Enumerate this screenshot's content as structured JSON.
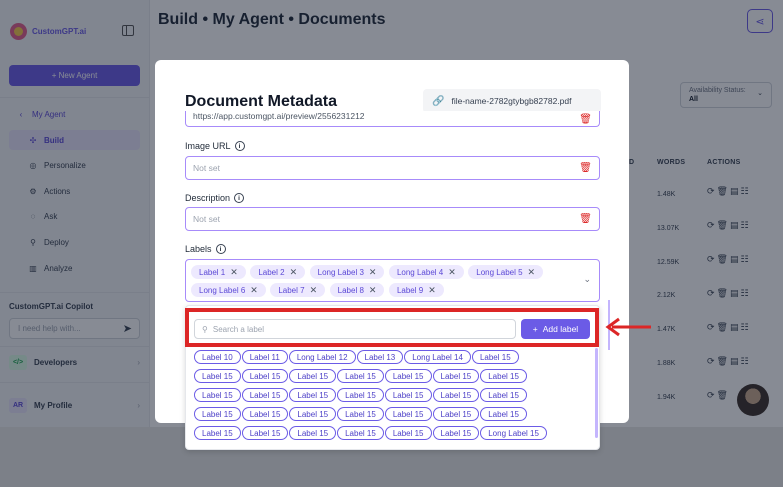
{
  "app": {
    "brand": "CustomGPT.ai",
    "new_agent": "+ New Agent",
    "nav_head": "My Agent",
    "nav": [
      {
        "label": "Build",
        "icon": "puzzle-icon"
      },
      {
        "label": "Personalize",
        "icon": "palette-icon"
      },
      {
        "label": "Actions",
        "icon": "bolt-icon"
      },
      {
        "label": "Ask",
        "icon": "chat-icon"
      },
      {
        "label": "Deploy",
        "icon": "rocket-icon"
      },
      {
        "label": "Analyze",
        "icon": "chart-icon"
      }
    ],
    "copilot_title": "CustomGPT.ai Copilot",
    "copilot_placeholder": "I need help with...",
    "developers": "Developers",
    "developers_badge": "</>",
    "profile": "My Profile",
    "profile_badge": "AR",
    "page_title": "Build • My Agent • Documents",
    "availability_label": "Availability Status:",
    "availability_value": "All",
    "col_d": "D",
    "col_words": "WORDS",
    "col_actions": "ACTIONS",
    "words": [
      "1.48K",
      "13.07K",
      "12.59K",
      "2.12K",
      "1.47K",
      "1.88K",
      "1.94K"
    ]
  },
  "modal": {
    "title": "Document Metadata",
    "file_name": "file-name-2782gtybgb82782.pdf",
    "url_value": "https://app.customgpt.ai/preview/2556231212",
    "image_url_label": "Image URL",
    "image_url_placeholder": "Not set",
    "description_label": "Description",
    "description_placeholder": "Not set",
    "labels_label": "Labels",
    "selected_labels": [
      "Label 1",
      "Label 2",
      "Long Label 3",
      "Long Label 4",
      "Long Label 5",
      "Long Label 6",
      "Label 7",
      "Label 8",
      "Label 9"
    ],
    "search_placeholder": "Search a label",
    "add_label": "Add label",
    "options": [
      "Label 10",
      "Label 11",
      "Long Label 12",
      "Label 13",
      "Long Label 14",
      "Label 15",
      "Label 15",
      "Label 15",
      "Label 15",
      "Label 15",
      "Label 15",
      "Label 15",
      "Label 15",
      "Label 15",
      "Label 15",
      "Label 15",
      "Label 15",
      "Label 15",
      "Label 15",
      "Label 15",
      "Label 15",
      "Label 15",
      "Label 15",
      "Label 15",
      "Label 15",
      "Label 15",
      "Label 15",
      "Label 15",
      "Label 15",
      "Label 15",
      "Label 15",
      "Label 15",
      "Label 15",
      "Long Label 15"
    ]
  },
  "colors": {
    "accent": "#6b5be6",
    "highlight": "#dc2626",
    "chip_bg": "#ede9fe"
  }
}
